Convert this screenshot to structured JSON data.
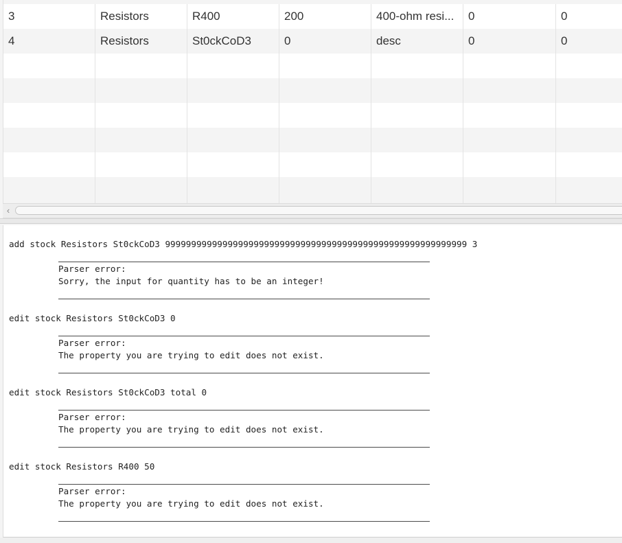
{
  "table": {
    "rows": [
      [
        "3",
        "Resistors",
        "R400",
        "200",
        "400-ohm resi...",
        "0",
        "0"
      ],
      [
        "4",
        "Resistors",
        "St0ckCoD3",
        "0",
        "desc",
        "0",
        "0"
      ],
      [
        "",
        "",
        "",
        "",
        "",
        "",
        ""
      ],
      [
        "",
        "",
        "",
        "",
        "",
        "",
        ""
      ],
      [
        "",
        "",
        "",
        "",
        "",
        "",
        ""
      ],
      [
        "",
        "",
        "",
        "",
        "",
        "",
        ""
      ],
      [
        "",
        "",
        "",
        "",
        "",
        "",
        ""
      ],
      [
        "",
        "",
        "",
        "",
        "",
        "",
        ""
      ]
    ]
  },
  "scrollbar": {
    "left_arrow": "‹"
  },
  "console": {
    "entries": [
      {
        "command": "add stock Resistors St0ckCoD3 9999999999999999999999999999999999999999999999999999999999 3",
        "error_title": "Parser error:",
        "error_message": "Sorry, the input for quantity has to be an integer!"
      },
      {
        "command": "edit stock Resistors St0ckCoD3 0",
        "error_title": "Parser error:",
        "error_message": "The property you are trying to edit does not exist."
      },
      {
        "command": "edit stock Resistors St0ckCoD3 total 0",
        "error_title": "Parser error:",
        "error_message": "The property you are trying to edit does not exist."
      },
      {
        "command": "edit stock Resistors R400 50",
        "error_title": "Parser error:",
        "error_message": "The property you are trying to edit does not exist."
      }
    ]
  }
}
